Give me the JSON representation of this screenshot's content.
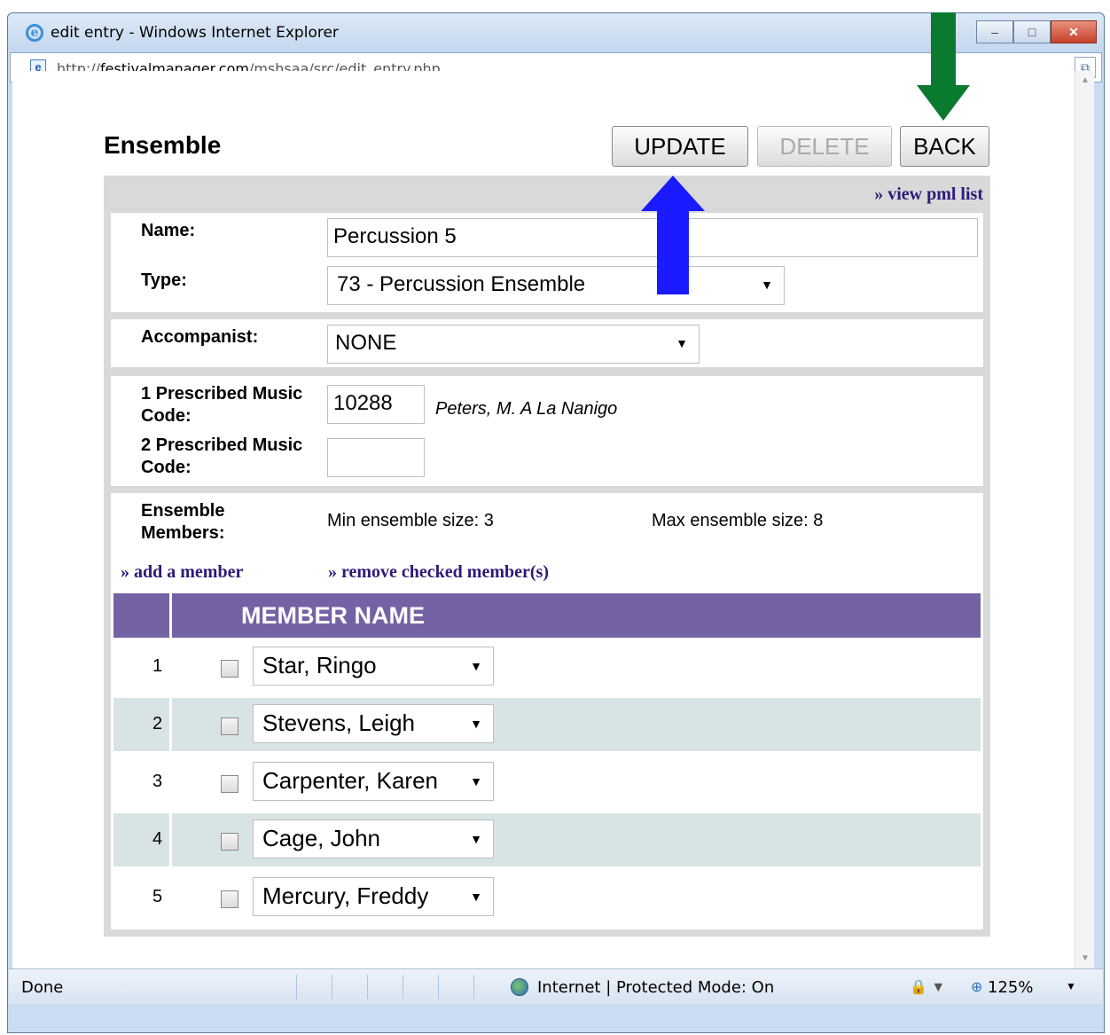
{
  "window": {
    "title": "edit entry - Windows Internet Explorer",
    "url_prefix": "http://",
    "url_domain": "festivalmanager.com",
    "url_path": "/mshsaa/src/edit_entry.php",
    "minimize_glyph": "–",
    "maximize_glyph": "□",
    "close_glyph": "✕",
    "icons": [
      "ie-logo-icon",
      "page-icon",
      "compatibility-view-icon",
      "globe-icon",
      "zoom-icon"
    ]
  },
  "form": {
    "title": "Ensemble",
    "buttons": {
      "update": "UPDATE",
      "delete": "DELETE",
      "back": "BACK"
    },
    "view_pml_link": "» view pml list",
    "name_label": "Name:",
    "name_value": "Percussion 5",
    "type_label": "Type:",
    "type_value": "73 - Percussion Ensemble",
    "accompanist_label": "Accompanist:",
    "accompanist_value": "NONE",
    "pm1_label_line1": "1 Prescribed Music",
    "pm1_label_line2": "Code:",
    "pm1_value": "10288",
    "pm1_title": "Peters, M. A La Nanigo",
    "pm2_label_line1": "2 Prescribed Music",
    "pm2_label_line2": "Code:",
    "pm2_value": "",
    "members_label_line1": "Ensemble",
    "members_label_line2": "Members:",
    "min_size": "Min ensemble size: 3",
    "max_size": "Max ensemble size: 8",
    "add_member_link": "» add a member",
    "remove_member_link": "» remove checked member(s)",
    "member_column_header": "MEMBER NAME",
    "members": [
      {
        "num": "1",
        "name": "Star, Ringo"
      },
      {
        "num": "2",
        "name": "Stevens, Leigh"
      },
      {
        "num": "3",
        "name": "Carpenter, Karen"
      },
      {
        "num": "4",
        "name": "Cage, John"
      },
      {
        "num": "5",
        "name": "Mercury, Freddy"
      }
    ]
  },
  "status_bar": {
    "left": "Done",
    "zone": "Internet | Protected Mode: On",
    "zoom": "125%"
  },
  "colors": {
    "member_header": "#7462a4",
    "alt_row": "#d8e4e4",
    "link": "#2c1a78",
    "up_arrow": "#1a1aff",
    "down_arrow": "#0a7a2e"
  }
}
